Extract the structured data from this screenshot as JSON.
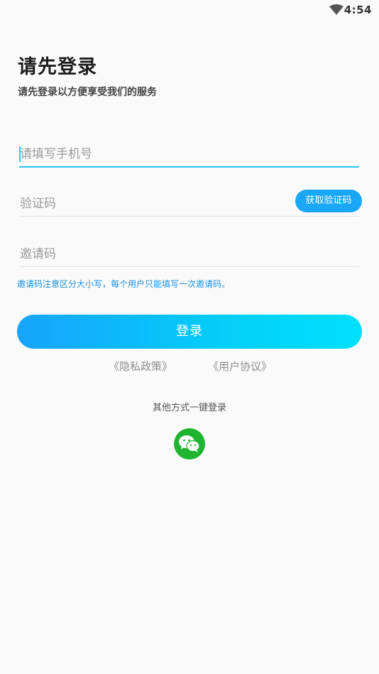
{
  "status_bar": {
    "time": "4:54",
    "wifi_icon": "wifi-icon"
  },
  "header": {
    "title": "请先登录",
    "subtitle": "请先登录以方便享受我们的服务"
  },
  "form": {
    "phone_placeholder": "请填写手机号",
    "code_placeholder": "验证码",
    "get_code_label": "获取验证码",
    "invite_placeholder": "邀请码",
    "invite_hint": "邀请码注意区分大小写，每个用户只能填写一次邀请码。"
  },
  "actions": {
    "login_label": "登录",
    "privacy_policy": "《隐私政策》",
    "user_agreement": "《用户协议》"
  },
  "other_login": {
    "label": "其他方式一键登录",
    "wechat_icon": "wechat-icon"
  },
  "colors": {
    "accent": "#1aa7f5",
    "gradient_start": "#17a4fb",
    "gradient_end": "#00e0fb",
    "wechat_green": "#1eb42f",
    "hint_blue": "#1b8fe0"
  }
}
